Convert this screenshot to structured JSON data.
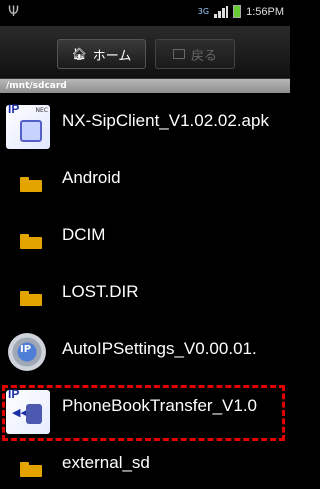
{
  "status_bar": {
    "time": "1:56PM",
    "network": "3G"
  },
  "toolbar": {
    "home_label": "ホーム",
    "back_label": "戻る"
  },
  "path": "/mnt/sdcard",
  "files": [
    {
      "name": "NX-SipClient_V1.02.02.apk",
      "type": "apk",
      "icon": "apk-icon",
      "icon_text": "IP"
    },
    {
      "name": "Android",
      "type": "folder",
      "icon": "folder-icon"
    },
    {
      "name": "DCIM",
      "type": "folder",
      "icon": "folder-icon"
    },
    {
      "name": "LOST.DIR",
      "type": "folder",
      "icon": "folder-icon"
    },
    {
      "name": "AutoIPSettings_V0.00.01.",
      "type": "apk",
      "icon": "gear-icon"
    },
    {
      "name": "PhoneBookTransfer_V1.0",
      "type": "apk",
      "icon": "phonebook-icon",
      "icon_text": "IP"
    },
    {
      "name": "external_sd",
      "type": "folder",
      "icon": "folder-icon"
    }
  ],
  "colors": {
    "highlight": "#e30000",
    "folder": "#e4a400",
    "path_bar": "#a0a0a0"
  }
}
